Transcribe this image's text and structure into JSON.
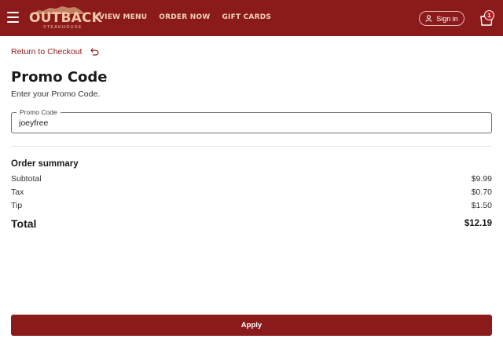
{
  "header": {
    "logo_text": "OUTBACK",
    "logo_subtext": "STEAKHOUSE",
    "nav": [
      {
        "label": "VIEW MENU"
      },
      {
        "label": "ORDER NOW"
      },
      {
        "label": "GIFT CARDS"
      }
    ],
    "signin_label": "Sign in",
    "bag_count": "1"
  },
  "main": {
    "back_link": "Return to Checkout",
    "title": "Promo Code",
    "description": "Enter your Promo Code.",
    "promo_field": {
      "label": "Promo Code",
      "value": "joeyfree"
    },
    "summary": {
      "title": "Order summary",
      "rows": [
        {
          "label": "Subtotal",
          "value": "$9.99"
        },
        {
          "label": "Tax",
          "value": "$0.70"
        },
        {
          "label": "Tip",
          "value": "$1.50"
        }
      ],
      "total_label": "Total",
      "total_value": "$12.19"
    },
    "apply_label": "Apply"
  },
  "colors": {
    "brand": "#8b1a1a",
    "logo": "#f3c9a8",
    "badge": "#b51c22"
  }
}
